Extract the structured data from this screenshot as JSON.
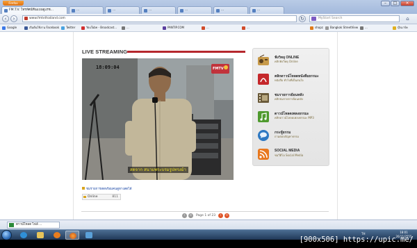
{
  "browser": {
    "menu_button_label": "Firefox",
    "tabs": [
      {
        "label": "FM.T.V. โทรทัศน์ทีนเเบบดูแรช..."
      },
      {
        "label": "..."
      },
      {
        "label": "..."
      },
      {
        "label": "..."
      },
      {
        "label": "..."
      },
      {
        "label": "..."
      },
      {
        "label": "..."
      }
    ],
    "url": "www.fmtvthailand.com",
    "search_placeholder": "MyStart Search",
    "bookmarks": [
      {
        "label": "Google"
      },
      {
        "label": "เริ่มต้นใช้งาน Facebook"
      },
      {
        "label": "Twitter"
      },
      {
        "label": "YouTube - Broadcast..."
      },
      {
        "label": "..."
      },
      {
        "label": "PANTIP.COM"
      },
      {
        "label": "..."
      },
      {
        "label": "..."
      },
      {
        "label": "shopz"
      },
      {
        "label": "Bangkok StreetView"
      },
      {
        "label": "..."
      }
    ],
    "bookmarks_overflow": "บุ๊กมาร์ค"
  },
  "page": {
    "heading": "LIVE STREAMING",
    "video": {
      "channel_logo": "FMTV",
      "timestamp": "18:09:04",
      "caption": "สดจาก สนามพระบรมรูปทรงม้า"
    },
    "video_link": "ชมรายการสดพร้อมคนดูทางสดได้",
    "online_label": "Online",
    "online_count": "811",
    "sidebar": [
      {
        "title": "ฟังวิทยุ ONLINE",
        "subtitle": "คลิกฟังวิทยุ Online",
        "icon": "radio-icon",
        "color": "#c79a4a"
      },
      {
        "title": "คลิกดาวน์โหลดหนังสือธรรมะ",
        "subtitle": "หนังสือ ทั่วไปที่เป็นสนใจ",
        "icon": "pdf-icon",
        "color": "#c5282b"
      },
      {
        "title": "ชมรายการย้อนหลัง",
        "subtitle": "คลิกชมรายการย้อนหลัง",
        "icon": "film-icon",
        "color": "#6a5a3a"
      },
      {
        "title": "ดาวน์โหลดเพลงธรรมะ",
        "subtitle": "คลิกดาวน์โหลดเพลงธรรมะ MP3",
        "icon": "music-icon",
        "color": "#4f9a2e"
      },
      {
        "title": "กระทู้ธรรม",
        "subtitle": "ถามตอบปัญหาธรรม",
        "icon": "chat-icon",
        "color": "#2d78c2"
      },
      {
        "title": "SOCIAL MEDIA",
        "subtitle": "ชมวีดีโอ Social Media",
        "icon": "rss-icon",
        "color": "#e8781e"
      }
    ],
    "pagination": {
      "label": "Page 1 of 23"
    }
  },
  "download": {
    "label": "ดาวน์โหลด ไฟล์ ..."
  },
  "taskbar": {
    "apps": [
      {
        "name": "ie"
      },
      {
        "name": "explorer"
      },
      {
        "name": "media-player"
      },
      {
        "name": "firefox",
        "active": true
      },
      {
        "name": "misc"
      }
    ],
    "lang": "TH",
    "time": "18:01",
    "date": "26/11/2555"
  },
  "watermark": "[900x506] https://upic.me/"
}
